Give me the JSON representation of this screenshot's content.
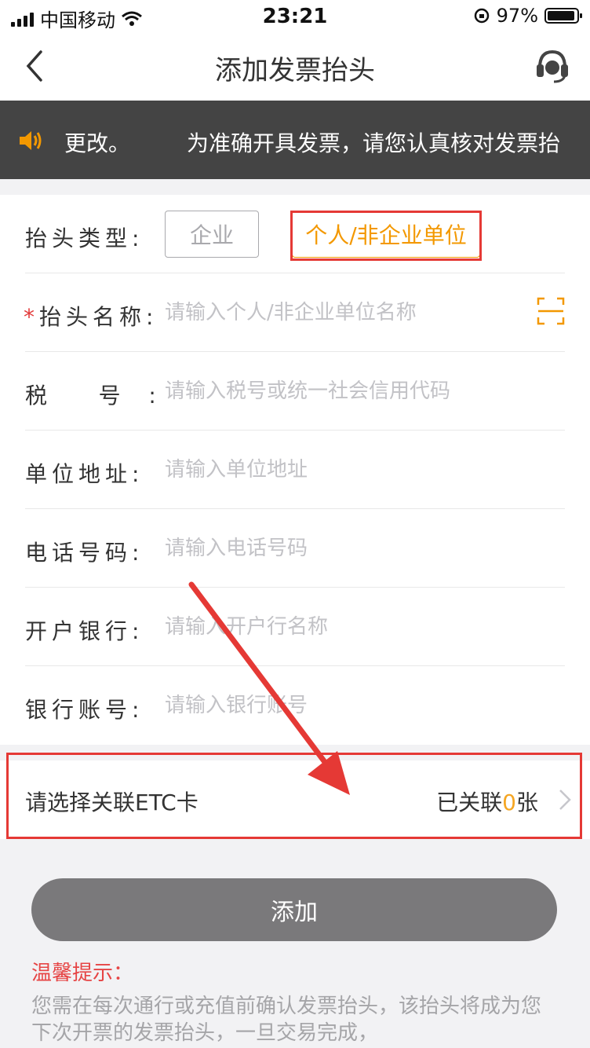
{
  "status_bar": {
    "carrier": "中国移动",
    "time": "23:21",
    "battery": "97%"
  },
  "nav": {
    "title": "添加发票抬头"
  },
  "notice": {
    "text_start": "更改。",
    "text_scroll": "为准确开具发票，请您认真核对发票抬"
  },
  "form": {
    "type": {
      "label": "抬头类型:",
      "options": [
        "企业",
        "个人/非企业单位"
      ],
      "selected": "个人/非企业单位"
    },
    "name": {
      "required_mark": "*",
      "label": "抬头名称:",
      "placeholder": "请输入个人/非企业单位名称"
    },
    "tax": {
      "label": "税    号  :",
      "placeholder": "请输入税号或统一社会信用代码"
    },
    "address": {
      "label": "单位地址:",
      "placeholder": "请输入单位地址"
    },
    "phone": {
      "label": "电话号码:",
      "placeholder": "请输入电话号码"
    },
    "bank": {
      "label": "开户银行:",
      "placeholder": "请输入开户行名称"
    },
    "account": {
      "label": "银行账号:",
      "placeholder": "请输入银行账号"
    }
  },
  "etc": {
    "label": "请选择关联ETC卡",
    "status_prefix": "已关联",
    "count": "0",
    "status_suffix": "张"
  },
  "add_button": "添加",
  "tips": {
    "title": "温馨提示：",
    "body": "您需在每次通行或充值前确认发票抬头，该抬头将成为您下次开票的发票抬头，一旦交易完成，"
  },
  "colors": {
    "accent": "#f39800",
    "annotation": "#e53935",
    "notice_bg": "#444444",
    "button_bg": "#7a797b"
  }
}
